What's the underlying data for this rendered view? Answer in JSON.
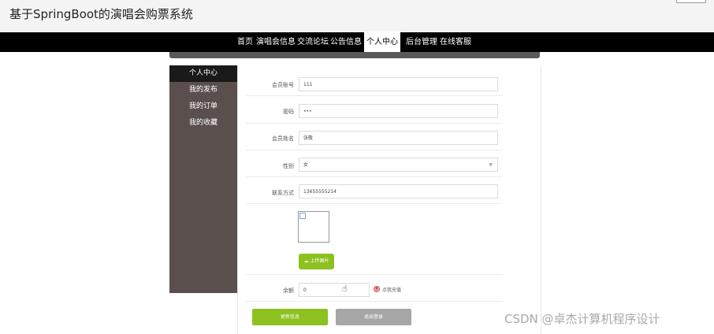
{
  "header": {
    "site_title": "基于SpringBoot的演唱会购票系统"
  },
  "nav": {
    "items": [
      "首页",
      "演唱会信息",
      "交流论坛",
      "公告信息",
      "个人中心",
      "后台管理",
      "在线客服"
    ],
    "active": "个人中心"
  },
  "sidebar": {
    "items": [
      "个人中心",
      "我的发布",
      "我的订单",
      "我的收藏"
    ],
    "active": "个人中心"
  },
  "form": {
    "account_label": "会员账号",
    "account_value": "111",
    "password_label": "密码",
    "password_value": "•••",
    "name_label": "会员姓名",
    "name_value": "张敬",
    "gender_label": "性别",
    "gender_value": "女",
    "phone_label": "联系方式",
    "phone_value": "13655555214",
    "upload_label": "上传图片",
    "balance_label": "余额",
    "balance_value": "0",
    "recharge_label": "点我充值",
    "update_label": "更新信息",
    "logout_label": "退出登录"
  },
  "watermark": "CSDN @卓杰计算机程序设计",
  "colors": {
    "accent": "#8cc11f",
    "nav_bg": "#000000",
    "sidebar_bg": "#5a4f4d"
  }
}
